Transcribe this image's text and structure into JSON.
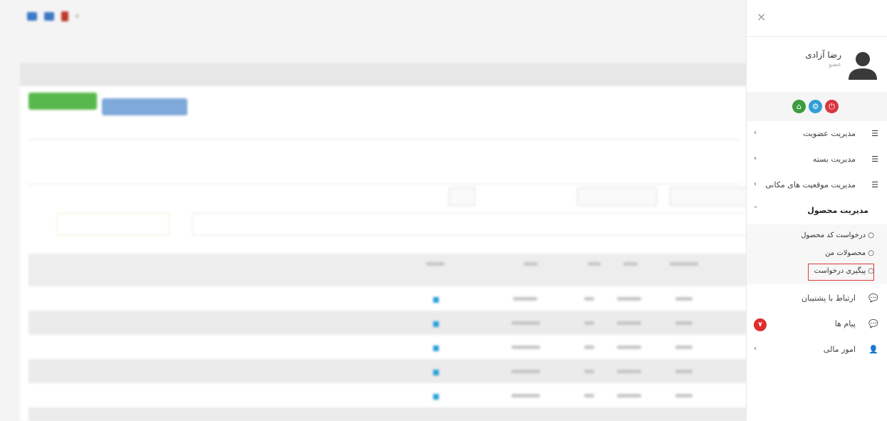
{
  "sidebar": {
    "close_icon": "×",
    "user_name": "رضا آزادی",
    "user_role": "عضو",
    "menu": [
      {
        "label": "مدیریت عضویت",
        "icon": "☰"
      },
      {
        "label": "مدیریت بسته",
        "icon": "☰"
      },
      {
        "label": "مدیریت موقعیت های مکانی",
        "icon": "☰"
      },
      {
        "label": "مدیریت محصول"
      }
    ],
    "submenu": [
      {
        "label": "○ درخواست کد محصول"
      },
      {
        "label": "○ محصولات من"
      },
      {
        "label": "○ پیگیری درخواست"
      }
    ],
    "bottom": [
      {
        "label": "ارتباط با پشتیبان",
        "icon": "💬"
      },
      {
        "label": "پیام ها",
        "icon": "💬",
        "badge": "۷"
      },
      {
        "label": "امور مالی",
        "icon": "👤"
      }
    ],
    "buttons": {
      "home": "⌂",
      "settings": "⚙",
      "power": "⏻"
    },
    "colors": {
      "green": "#3c9c3e",
      "blue": "#2f9fd9",
      "red": "#d9363e",
      "highlight": "#e03b3b"
    }
  }
}
